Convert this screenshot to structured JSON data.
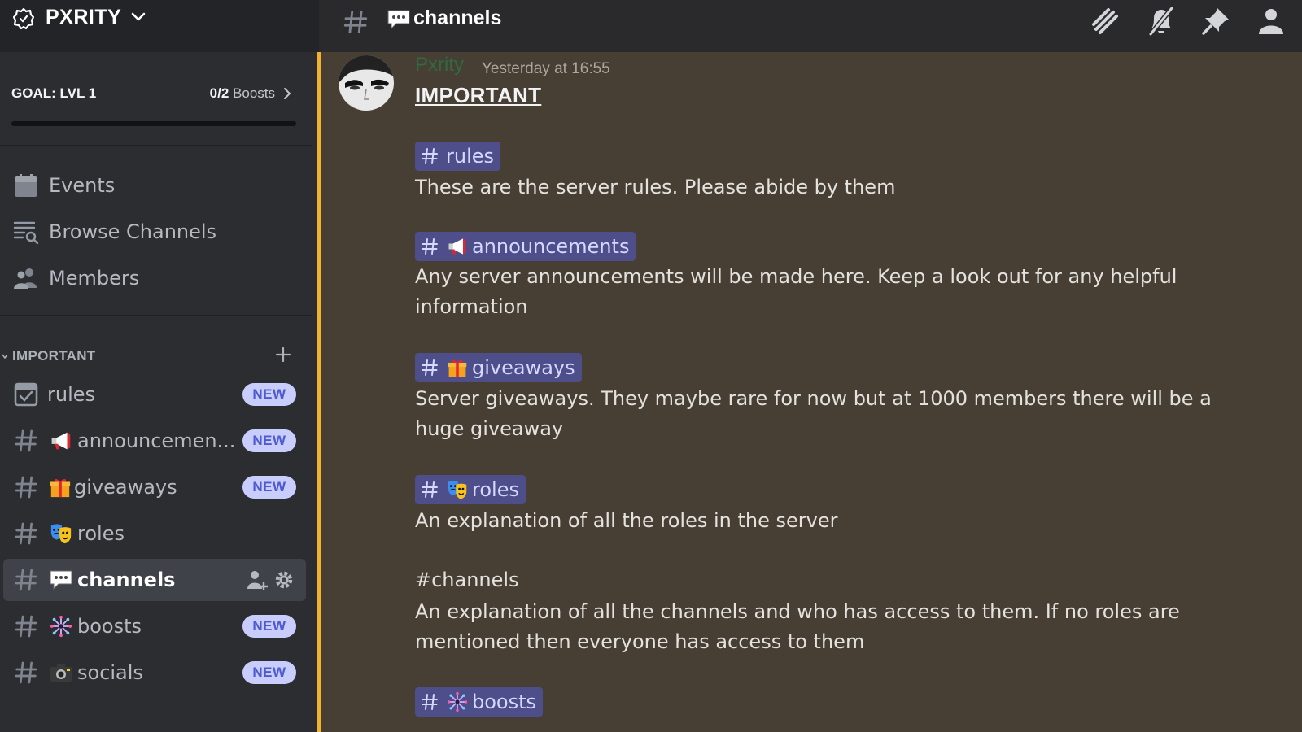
{
  "server": {
    "name": "PXRITY"
  },
  "boost_goal": {
    "goal": "GOAL: LVL 1",
    "current": "0/2",
    "suffix": " Boosts",
    "progress": 0
  },
  "nav": [
    {
      "label": "Events",
      "icon": "calendar-icon"
    },
    {
      "label": "Browse Channels",
      "icon": "browse-channels-icon"
    },
    {
      "label": "Members",
      "icon": "members-icon"
    }
  ],
  "category": {
    "label": "IMPORTANT"
  },
  "channels": [
    {
      "name": "rules",
      "icon": "rules-checkbox-icon",
      "emoji": "",
      "badge": "NEW"
    },
    {
      "name": "announcemen...",
      "icon": "hash-icon",
      "emoji": "megaphone-emoji",
      "badge": "NEW"
    },
    {
      "name": "giveaways",
      "icon": "hash-icon",
      "emoji": "gift-emoji",
      "badge": "NEW"
    },
    {
      "name": "roles",
      "icon": "hash-icon",
      "emoji": "masks-emoji",
      "badge": ""
    },
    {
      "name": "channels",
      "icon": "hash-icon",
      "emoji": "speech-bubble-emoji",
      "badge": "",
      "active": true
    },
    {
      "name": "boosts",
      "icon": "hash-icon",
      "emoji": "firework-emoji",
      "badge": "NEW"
    },
    {
      "name": "socials",
      "icon": "hash-icon",
      "emoji": "camera-emoji",
      "badge": "NEW"
    }
  ],
  "topbar": {
    "title": "channels",
    "icons": [
      "threads-icon",
      "mute-bell-icon",
      "pin-icon",
      "member-list-icon"
    ]
  },
  "message": {
    "author": "Pxrity",
    "timestamp": "Yesterday at 16:55",
    "heading": "IMPORTANT",
    "sections": [
      {
        "mention": "rules",
        "emoji": "",
        "description": "These are the server rules. Please abide by them"
      },
      {
        "mention": "announcements",
        "emoji": "megaphone-emoji",
        "description": "Any server announcements will be made here. Keep a look out for any helpful information"
      },
      {
        "mention": "giveaways",
        "emoji": "gift-emoji",
        "description": "Server giveaways. They maybe rare for now but at 1000 members there will be a huge giveaway"
      },
      {
        "mention": "roles",
        "emoji": "masks-emoji",
        "description": "An explanation of all the roles in the server"
      },
      {
        "plain": "#channels",
        "description": "An explanation of all the channels and who has access to them. If no roles are mentioned then everyone has access to them"
      },
      {
        "mention": "boosts",
        "emoji": "firework-emoji",
        "description": ""
      }
    ]
  },
  "colors": {
    "sidebar": "#2b2d31",
    "chat_bg": "#473f34",
    "accent_line": "#f0b232",
    "mention_bg": "#4d4e8a",
    "badge_bg": "#c9cdfb",
    "badge_text": "#4e5ad0"
  }
}
